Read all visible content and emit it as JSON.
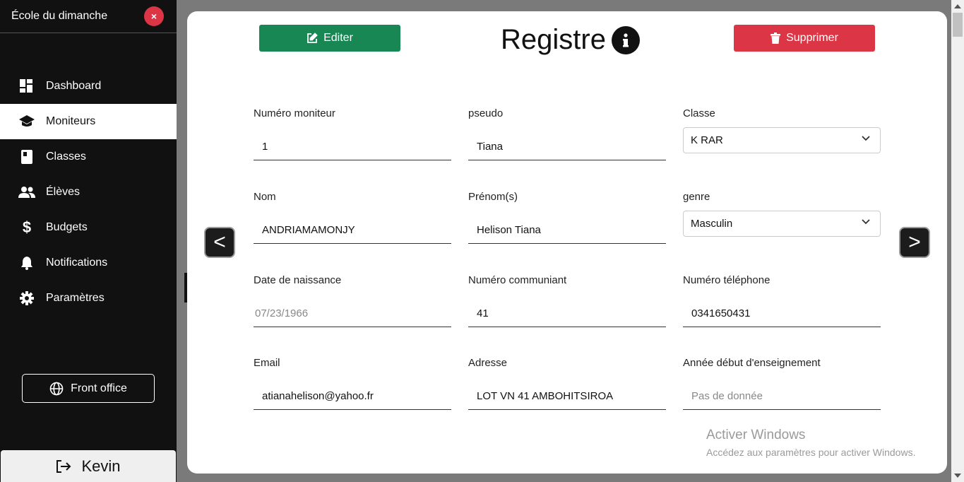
{
  "sidebar": {
    "title": "École du dimanche",
    "close_label": "×",
    "items": [
      {
        "label": "Dashboard",
        "icon": "dashboard-icon"
      },
      {
        "label": "Moniteurs",
        "icon": "graduation-cap-icon"
      },
      {
        "label": "Classes",
        "icon": "book-icon"
      },
      {
        "label": "Élèves",
        "icon": "people-icon"
      },
      {
        "label": "Budgets",
        "icon": "dollar-icon"
      },
      {
        "label": "Notifications",
        "icon": "bell-icon"
      },
      {
        "label": "Paramètres",
        "icon": "gear-icon"
      }
    ],
    "active_item": "Moniteurs",
    "front_office_label": "Front office",
    "user_name": "Kevin"
  },
  "modal": {
    "title": "Registre",
    "edit_label": "Editer",
    "delete_label": "Supprimer",
    "prev_label": "<",
    "next_label": ">",
    "fields": {
      "numero_moniteur": {
        "label": "Numéro moniteur",
        "value": "1"
      },
      "pseudo": {
        "label": "pseudo",
        "value": "Tiana"
      },
      "classe": {
        "label": "Classe",
        "value": "K RAR"
      },
      "nom": {
        "label": "Nom",
        "value": "ANDRIAMAMONJY"
      },
      "prenoms": {
        "label": "Prénom(s)",
        "value": "Helison Tiana"
      },
      "genre": {
        "label": "genre",
        "value": "Masculin"
      },
      "date_naissance": {
        "label": "Date de naissance",
        "value": "07/23/1966"
      },
      "numero_communiant": {
        "label": "Numéro communiant",
        "value": "41"
      },
      "numero_telephone": {
        "label": "Numéro téléphone",
        "value": "0341650431"
      },
      "email": {
        "label": "Email",
        "value": "atianahelison@yahoo.fr"
      },
      "adresse": {
        "label": "Adresse",
        "value": "LOT VN 41 AMBOHITSIROA"
      },
      "annee_debut": {
        "label": "Année début d'enseignement",
        "placeholder": "Pas de donnée"
      }
    }
  },
  "watermark": {
    "line1": "Activer Windows",
    "line2": "Accédez aux paramètres pour activer Windows."
  },
  "colors": {
    "sidebar_bg": "#111111",
    "edit_green": "#198754",
    "delete_red": "#dc3545",
    "overlay_gray": "#7a7a7a"
  }
}
